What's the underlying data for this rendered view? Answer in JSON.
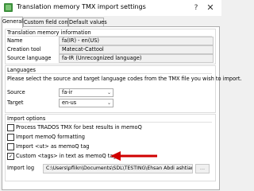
{
  "window": {
    "title": "Translation memory TMX import settings",
    "help_label": "?",
    "close_label": "✕"
  },
  "tabs": [
    {
      "label": "General"
    },
    {
      "label": "Custom field conflicts"
    },
    {
      "label": "Default values"
    }
  ],
  "tm_info": {
    "title": "Translation memory information",
    "rows": [
      {
        "label": "Name",
        "value": "fa(IR) - en(US)"
      },
      {
        "label": "Creation tool",
        "value": "Matecat-Cattool"
      },
      {
        "label": "Source language",
        "value": "fa-IR (Unrecognized language)"
      }
    ]
  },
  "languages": {
    "title": "Languages",
    "description": "Please select the source and target language codes from the TMX file you wish to import.",
    "source_label": "Source",
    "source_value": "fa-ir",
    "target_label": "Target",
    "target_value": "en-us"
  },
  "import_options": {
    "title": "Import options",
    "options": [
      {
        "label": "Process TRADOS TMX for best results in memoQ",
        "checked": false,
        "mark": ""
      },
      {
        "label": "Import memoQ formatting",
        "checked": false,
        "mark": ""
      },
      {
        "label": "Import <ut> as memoQ tag",
        "checked": false,
        "mark": ""
      },
      {
        "label": "Custom <tags> in text as memoQ tags",
        "checked": true,
        "mark": "✓"
      }
    ],
    "import_log_label": "Import log",
    "import_log_path": "C:\\Users\\pflikn\\Documents\\SDL\\TESTING\\Ehsan Abdi ashtiani's",
    "browse_label": "...",
    "arrow_color": "#d00000"
  }
}
